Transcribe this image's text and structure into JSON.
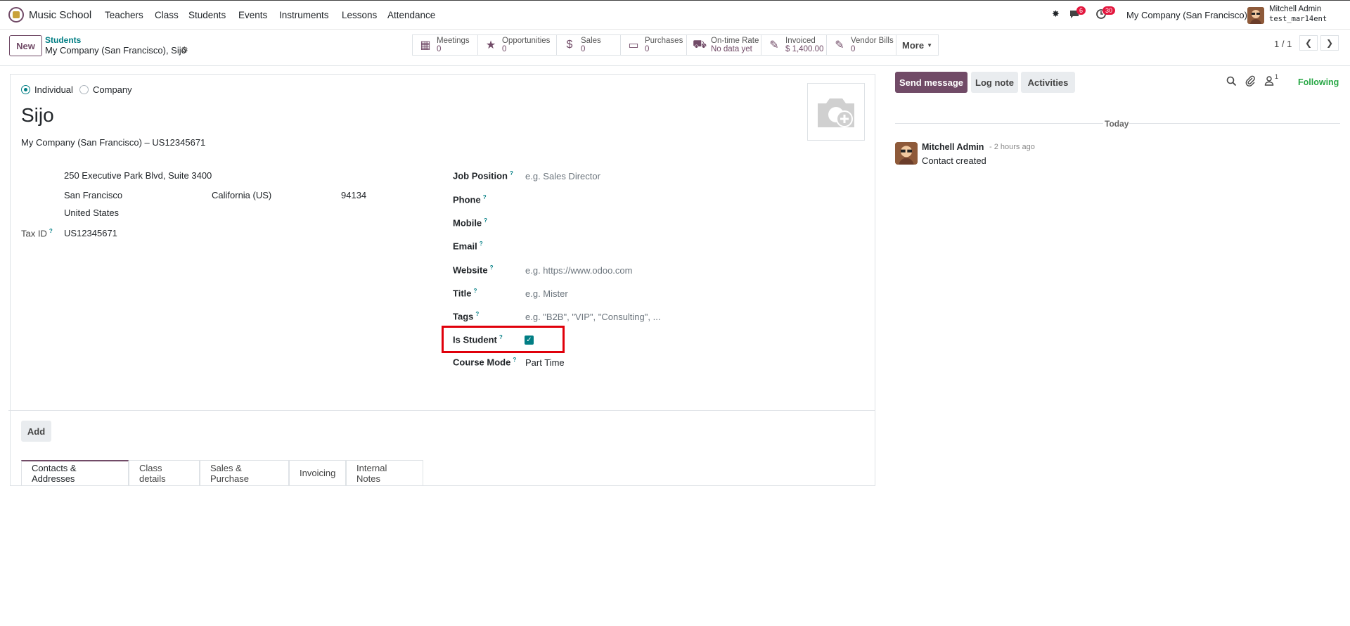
{
  "navbar": {
    "app_name": "Music School",
    "menu": [
      "Teachers",
      "Class",
      "Students",
      "Events",
      "Instruments",
      "Lessons",
      "Attendance"
    ],
    "messages_count": "6",
    "activities_count": "30",
    "company": "My Company (San Francisco)",
    "user_name": "Mitchell Admin",
    "db_name": "test_mar14ent"
  },
  "control": {
    "new_label": "New",
    "breadcrumb_parent": "Students",
    "breadcrumb_current": "My Company (San Francisco), Sijo",
    "stats": [
      {
        "label": "Meetings",
        "value": "0",
        "icon": "calendar-icon"
      },
      {
        "label": "Opportunities",
        "value": "0",
        "icon": "star-icon"
      },
      {
        "label": "Sales",
        "value": "0",
        "icon": "dollar-icon"
      },
      {
        "label": "Purchases",
        "value": "0",
        "icon": "credit-card-icon"
      },
      {
        "label": "On-time Rate",
        "value": "No data yet",
        "icon": "truck-icon"
      },
      {
        "label": "Invoiced",
        "value": "$ 1,400.00",
        "icon": "pencil-square-icon"
      },
      {
        "label": "Vendor Bills",
        "value": "0",
        "icon": "pencil-square-icon"
      }
    ],
    "more_label": "More",
    "pager": "1 / 1"
  },
  "form": {
    "type_individual": "Individual",
    "type_company": "Company",
    "type_selected": "Individual",
    "name": "Sijo",
    "company_line": "My Company (San Francisco) – US12345671",
    "address": {
      "street": "250 Executive Park Blvd, Suite 3400",
      "city": "San Francisco",
      "state": "California (US)",
      "zip": "94134",
      "country": "United States"
    },
    "tax_label": "Tax ID",
    "tax_value": "US12345671",
    "fields": {
      "job_position": {
        "label": "Job Position",
        "placeholder": "e.g. Sales Director"
      },
      "phone": {
        "label": "Phone"
      },
      "mobile": {
        "label": "Mobile"
      },
      "email": {
        "label": "Email"
      },
      "website": {
        "label": "Website",
        "placeholder": "e.g. https://www.odoo.com"
      },
      "title": {
        "label": "Title",
        "placeholder": "e.g. Mister"
      },
      "tags": {
        "label": "Tags",
        "placeholder": "e.g. \"B2B\", \"VIP\", \"Consulting\", ..."
      },
      "is_student": {
        "label": "Is Student",
        "checked": true
      },
      "course_mode": {
        "label": "Course Mode",
        "value": "Part Time"
      }
    },
    "tabs": [
      "Contacts & Addresses",
      "Class details",
      "Sales & Purchase",
      "Invoicing",
      "Internal Notes"
    ],
    "active_tab": "Contacts & Addresses",
    "add_label": "Add"
  },
  "chatter": {
    "send_message": "Send message",
    "log_note": "Log note",
    "activities": "Activities",
    "followers_count": "1",
    "following": "Following",
    "date_separator": "Today",
    "message": {
      "author": "Mitchell Admin",
      "time": "- 2 hours ago",
      "body": "Contact created"
    }
  },
  "colors": {
    "brand": "#714b67",
    "accent": "#017e84",
    "highlight": "#e0000b"
  }
}
